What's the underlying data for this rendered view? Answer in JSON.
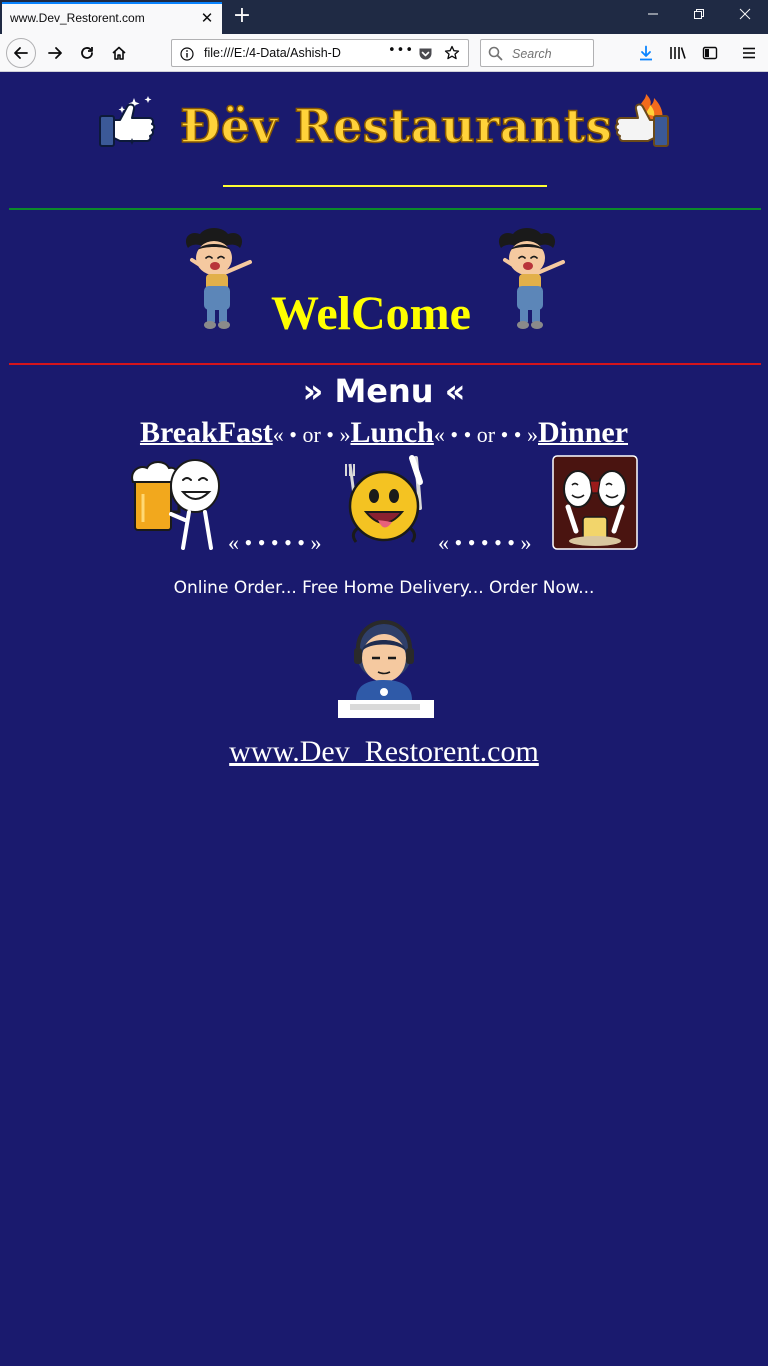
{
  "browser": {
    "tab_title": "www.Dev_Restorent.com",
    "url": "file:///E:/4-Data/Ashish-D",
    "search_placeholder": "Search"
  },
  "header": {
    "title": "Đëv Restaurants"
  },
  "welcome": {
    "text": "WelCome"
  },
  "menu": {
    "heading": "» Menu «",
    "items": [
      {
        "label": "BreakFast"
      },
      {
        "label": "Lunch"
      },
      {
        "label": "Dinner"
      }
    ],
    "separators": [
      "« • or • »",
      "« • • or • • »"
    ],
    "dots": [
      "« • • • • • »",
      "« • • • • • »"
    ]
  },
  "promo": {
    "tagline": "Online Order... Free Home Delivery... Order Now..."
  },
  "footer": {
    "site_link": "www.Dev_Restorent.com"
  },
  "colors": {
    "page_bg": "#1a1a6e",
    "title_gold": "#ffd23a",
    "welcome_yellow": "#ffff00",
    "rule_green": "#0b8a2a",
    "rule_red": "#d4141c"
  }
}
